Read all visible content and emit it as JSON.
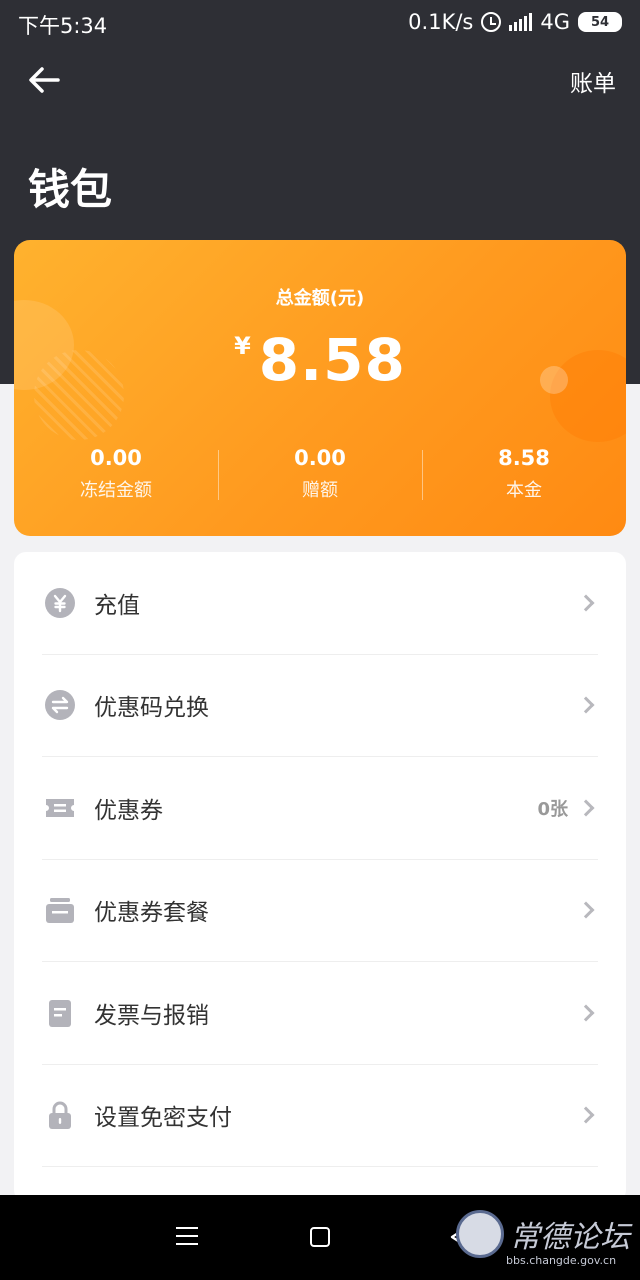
{
  "status_bar": {
    "time": "下午5:34",
    "network_speed": "0.1K/s",
    "network_type": "4G",
    "battery": "54",
    "icons": [
      "alarm-icon",
      "signal-icon",
      "battery-icon"
    ]
  },
  "nav": {
    "back_icon": "back-arrow-icon",
    "bill_label": "账单"
  },
  "page": {
    "title": "钱包"
  },
  "balance": {
    "label": "总金额(元)",
    "currency": "¥",
    "amount": "8.58",
    "stats": [
      {
        "value": "0.00",
        "label": "冻结金额"
      },
      {
        "value": "0.00",
        "label": "赠额"
      },
      {
        "value": "8.58",
        "label": "本金"
      }
    ],
    "colors": {
      "start": "#ffb22e",
      "end": "#ff8a12"
    }
  },
  "menu": {
    "items": [
      {
        "label": "充值",
        "icon": "yen-circle-icon",
        "extra": ""
      },
      {
        "label": "优惠码兑换",
        "icon": "exchange-circle-icon",
        "extra": ""
      },
      {
        "label": "优惠券",
        "icon": "coupon-icon",
        "extra": "0张"
      },
      {
        "label": "优惠券套餐",
        "icon": "coupon-package-icon",
        "extra": ""
      },
      {
        "label": "发票与报销",
        "icon": "invoice-icon",
        "extra": ""
      },
      {
        "label": "设置免密支付",
        "icon": "lock-icon",
        "extra": ""
      }
    ]
  },
  "system_nav": {
    "icons": [
      "menu-lines-icon",
      "home-square-icon",
      "back-triangle-icon"
    ]
  },
  "watermark": {
    "text": "常德论坛",
    "url": "bbs.changde.gov.cn"
  },
  "colors": {
    "header_bg": "#2e2f35",
    "page_bg": "#f2f2f4",
    "icon_gray": "#b3b3ba"
  }
}
